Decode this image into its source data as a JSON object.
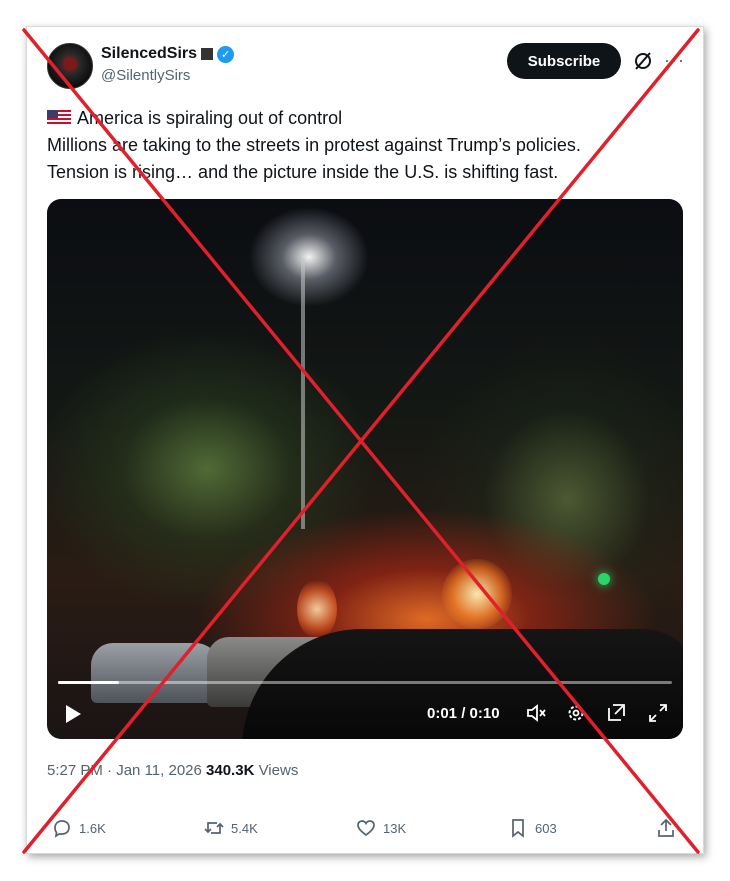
{
  "author": {
    "display_name": "SilencedSirs",
    "handle": "@SilentlySirs"
  },
  "header": {
    "subscribe_label": "Subscribe",
    "more_label": "···"
  },
  "tweet": {
    "line1": "America is spiraling out of control",
    "line2": "Millions are taking to the streets in protest against Trump’s policies.",
    "line3": "Tension is rising… and the picture inside the U.S. is shifting fast."
  },
  "video": {
    "time_display": "0:01 / 0:10",
    "progress_fraction": 0.1
  },
  "meta": {
    "time": "5:27 PM",
    "separator": "·",
    "date": "Jan 11, 2026",
    "views_count": "340.3K",
    "views_label": "Views"
  },
  "actions": {
    "replies": "1.6K",
    "reposts": "5.4K",
    "likes": "13K",
    "bookmarks": "603"
  },
  "icons": [
    "verified-badge-icon",
    "grok-icon",
    "more-icon",
    "us-flag-icon",
    "play-icon",
    "mute-icon",
    "settings-icon",
    "pip-icon",
    "fullscreen-icon",
    "reply-icon",
    "repost-icon",
    "like-icon",
    "bookmark-icon",
    "share-icon"
  ],
  "colors": {
    "accent": "#1d9bf0",
    "overlay_x": "#e0202a",
    "text_primary": "#0f1419",
    "text_secondary": "#536471"
  }
}
